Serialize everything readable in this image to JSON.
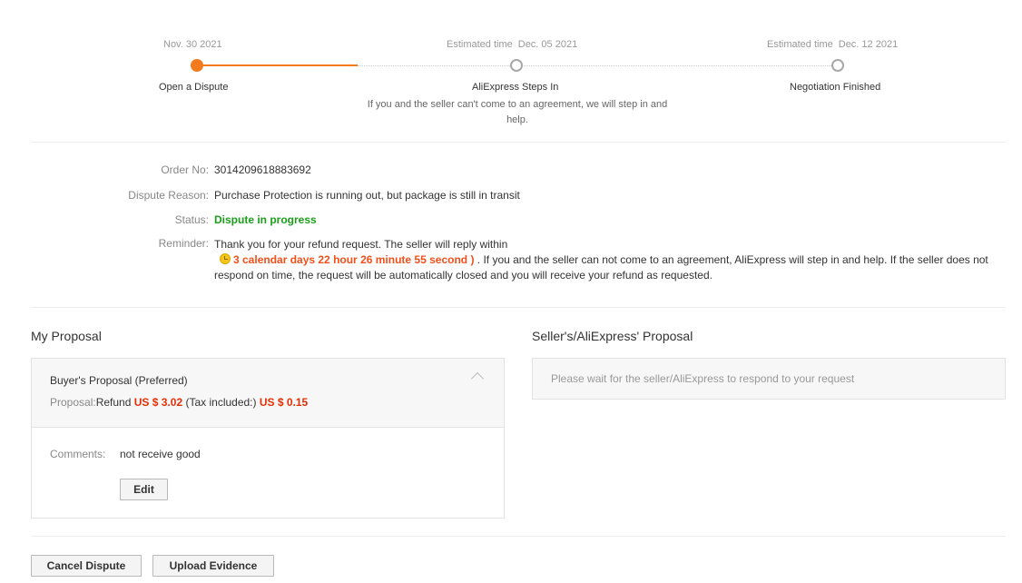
{
  "steps": [
    {
      "prefix": "",
      "date": "Nov. 30 2021",
      "label": "Open a Dispute",
      "state": "done"
    },
    {
      "prefix": "Estimated time",
      "date": "Dec. 05 2021",
      "label": "AliExpress Steps In",
      "description": "If you and the seller can't come to an agreement, we will step in and help.",
      "state": "pending"
    },
    {
      "prefix": "Estimated time",
      "date": "Dec. 12 2021",
      "label": "Negotiation Finished",
      "state": "pending"
    }
  ],
  "info": {
    "order_label": "Order No:",
    "order_value": "3014209618883692",
    "reason_label": "Dispute Reason:",
    "reason_value": "Purchase Protection is running out, but package is still in transit",
    "status_label": "Status:",
    "status_value": "Dispute in progress",
    "reminder_label": "Reminder:",
    "reminder_text_before": "Thank you for your refund request. The seller will reply within",
    "countdown": "3 calendar days 22 hour 26 minute 55 second )",
    "reminder_text_after": ". If you and the seller can not come to an agreement, AliExpress will step in and help. If the seller does not respond on time, the request will be automatically closed and you will receive your refund as requested."
  },
  "my_proposal": {
    "section_title": "My Proposal",
    "title": "Buyer's Proposal (Preferred)",
    "proposal_key": "Proposal:",
    "refund_text": "Refund",
    "refund_amount": "US $ 3.02",
    "tax_text": "(Tax included:)",
    "tax_amount": "US $ 0.15",
    "comments_label": "Comments:",
    "comments_value": "not receive good",
    "edit_label": "Edit"
  },
  "seller_proposal": {
    "section_title": "Seller's/AliExpress' Proposal",
    "message": "Please wait for the seller/AliExpress to respond to your request"
  },
  "actions": {
    "cancel_label": "Cancel Dispute",
    "upload_label": "Upload Evidence"
  },
  "colors": {
    "accent": "#f37b1d",
    "status": "#1a9e1a",
    "money": "#e62e04"
  }
}
